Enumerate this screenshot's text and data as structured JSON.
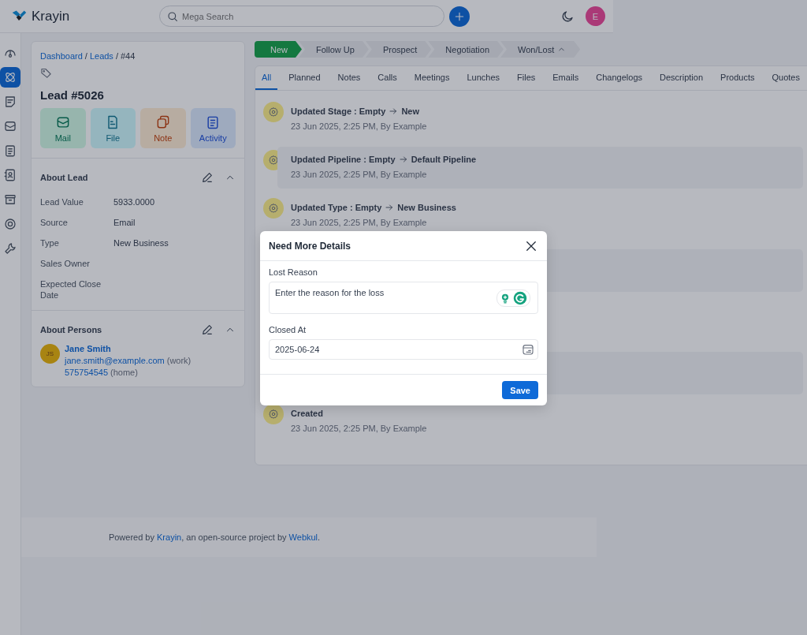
{
  "header": {
    "logo": "Krayin",
    "search": {
      "placeholder": "Mega Search"
    },
    "avatar": "E"
  },
  "sidebar": {
    "items": [
      {
        "selected": false
      },
      {
        "selected": true
      },
      {
        "selected": false
      },
      {
        "selected": false
      },
      {
        "selected": false
      },
      {
        "selected": false
      },
      {
        "selected": false
      },
      {
        "selected": false
      },
      {
        "selected": false
      }
    ]
  },
  "lead": {
    "breadcrumb": [
      {
        "label": "Dashboard",
        "kind": "link"
      },
      {
        "label": "/",
        "kind": "separator"
      },
      {
        "label": "Leads",
        "kind": "link"
      },
      {
        "label": "/",
        "kind": "separator"
      },
      {
        "label": "#44",
        "kind": "current"
      }
    ],
    "title": "Lead #5026",
    "actions": [
      {
        "label": "Mail",
        "kind": "mail"
      },
      {
        "label": "File",
        "kind": "file"
      },
      {
        "label": "Note",
        "kind": "note"
      },
      {
        "label": "Activity",
        "kind": "activity"
      }
    ]
  },
  "about_lead": {
    "title": "About Lead",
    "fields": [
      {
        "label": "Lead Value",
        "value": "5933.0000"
      },
      {
        "label": "Source",
        "value": "Email"
      },
      {
        "label": "Type",
        "value": "New Business"
      },
      {
        "label": "Sales Owner"
      },
      {
        "label": "Expected Close Date"
      }
    ]
  },
  "about_persons": {
    "title": "About Persons",
    "persons": [
      {
        "initials": "JS",
        "name": "Jane Smith",
        "email": "jane.smith@example.com",
        "email_type": "(work)",
        "phone": "575754545",
        "phone_type": "(home)"
      }
    ]
  },
  "stages": [
    {
      "label": "New",
      "selected": true
    },
    {
      "label": "Follow Up",
      "selected": false
    },
    {
      "label": "Prospect",
      "selected": false
    },
    {
      "label": "Negotiation",
      "selected": false
    },
    {
      "label": "Won/Lost",
      "selected": false,
      "kind": "dropdown"
    }
  ],
  "tabs": [
    {
      "label": "All",
      "selected": true
    },
    {
      "label": "Planned",
      "selected": false
    },
    {
      "label": "Notes",
      "selected": false
    },
    {
      "label": "Calls",
      "selected": false
    },
    {
      "label": "Meetings",
      "selected": false
    },
    {
      "label": "Lunches",
      "selected": false
    },
    {
      "label": "Files",
      "selected": false
    },
    {
      "label": "Emails",
      "selected": false
    },
    {
      "label": "Changelogs",
      "selected": false
    },
    {
      "label": "Description",
      "selected": false
    },
    {
      "label": "Products",
      "selected": false
    },
    {
      "label": "Quotes",
      "selected": false
    }
  ],
  "timeline": [
    {
      "title": "Updated Stage : Empty",
      "to": "New",
      "meta": "23 Jun 2025, 2:25 PM, By Example",
      "highlighted": false
    },
    {
      "title": "Updated Pipeline : Empty",
      "to": "Default Pipeline",
      "meta": "23 Jun 2025, 2:25 PM, By Example",
      "highlighted": true
    },
    {
      "title": "Updated Type : Empty",
      "to": "New Business",
      "meta": "23 Jun 2025, 2:25 PM, By Example",
      "highlighted": false
    },
    {
      "title": "Created",
      "meta": "23 Jun 2025, 2:25 PM, By Example",
      "highlighted": false
    }
  ],
  "modal": {
    "title": "Need More Details",
    "fields": [
      {
        "label": "Lost Reason",
        "kind": "textarea",
        "placeholder": "Enter the reason for the loss"
      },
      {
        "label": "Closed At",
        "kind": "date",
        "value": "2025-06-24"
      }
    ],
    "save": "Save"
  },
  "footer": {
    "before": "Powered by ",
    "link1": "Krayin",
    "middle": ", an open-source project by ",
    "link2": "Webkul",
    "after": "."
  }
}
